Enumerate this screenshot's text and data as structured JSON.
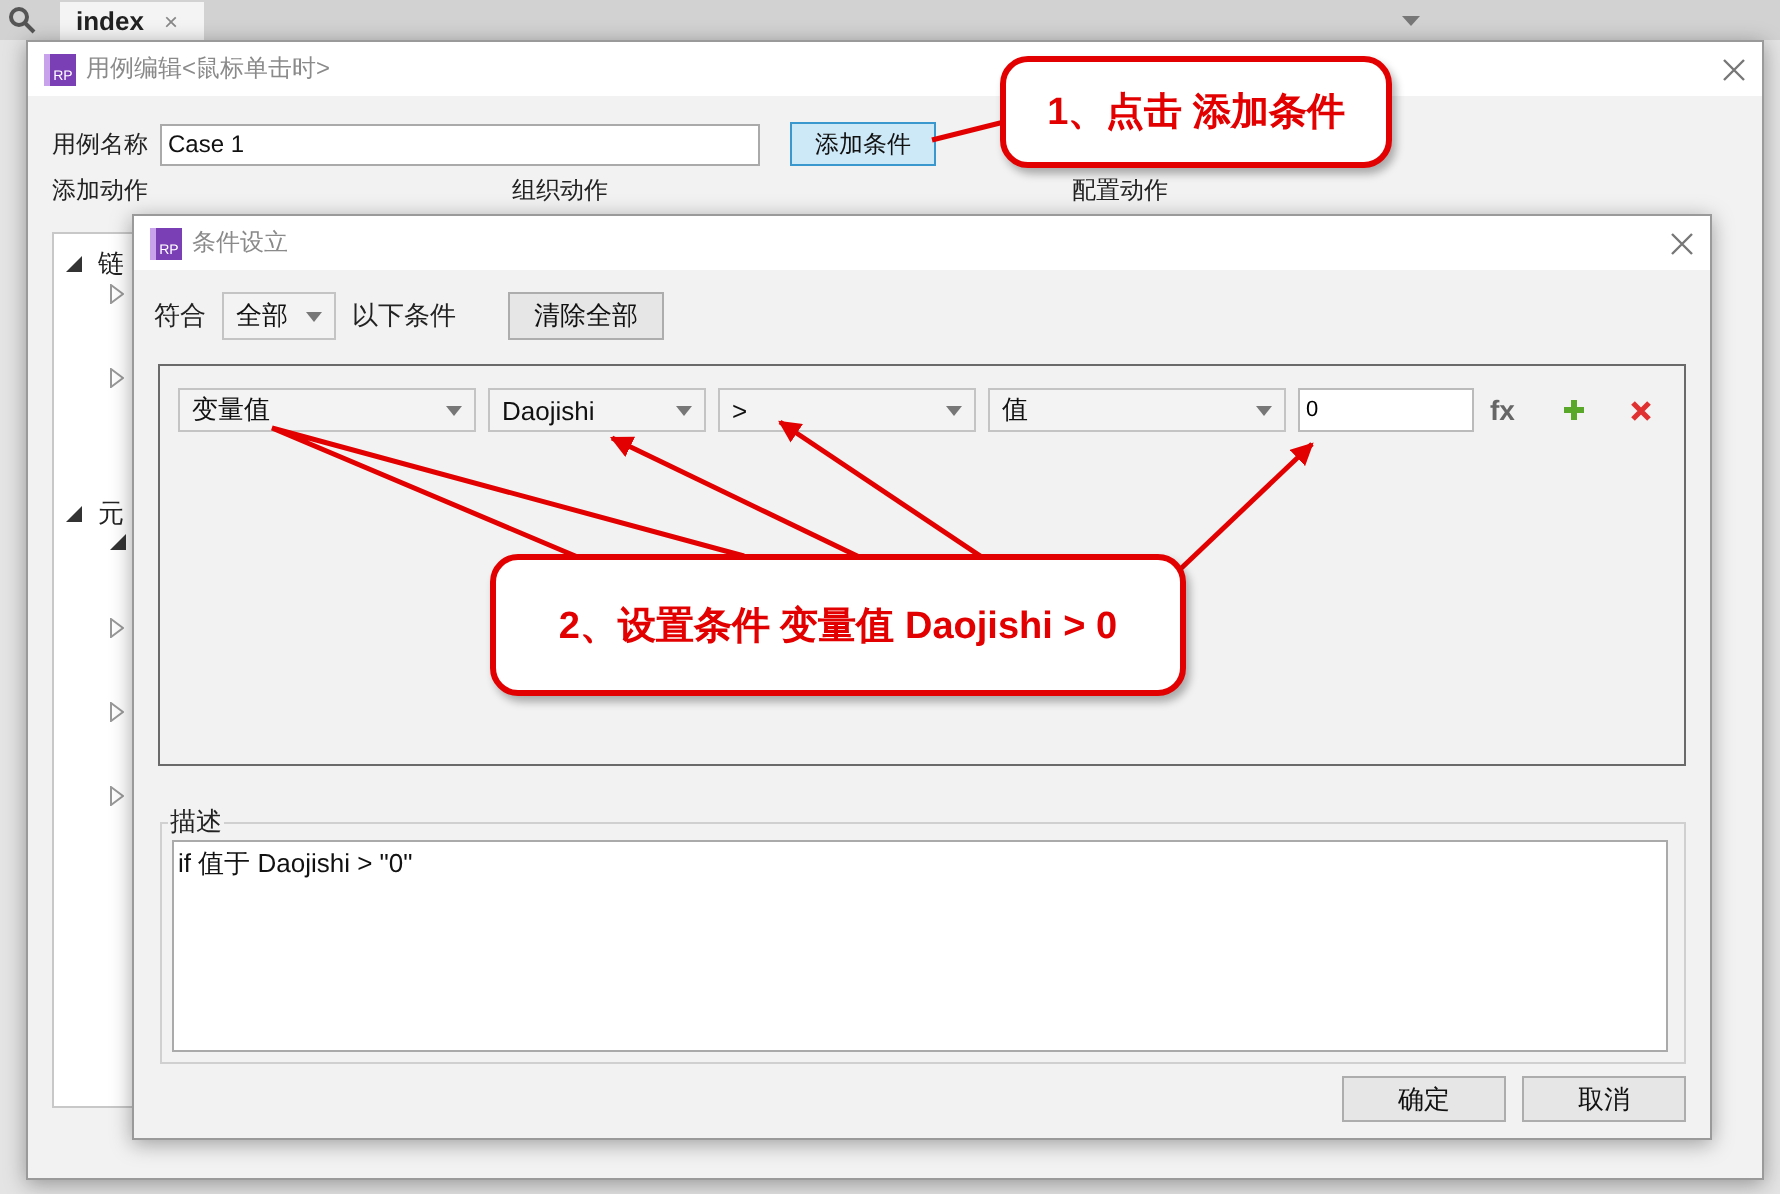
{
  "background": {
    "tab": {
      "label": "index",
      "close": "×"
    }
  },
  "case_dialog": {
    "logo": "RP",
    "title": "用例编辑<鼠标单击时>",
    "name_label": "用例名称",
    "name_value": "Case 1",
    "add_condition_button": "添加条件",
    "columns": [
      "添加动作",
      "组织动作",
      "配置动作"
    ],
    "tree": [
      {
        "label": "链",
        "expanded": true,
        "children": [
          {
            "expanded": false
          },
          {
            "expanded": false
          }
        ]
      },
      {
        "label": "元",
        "expanded": true,
        "children": [
          {
            "expanded": true
          },
          {
            "expanded": false
          },
          {
            "expanded": false
          },
          {
            "expanded": false
          }
        ]
      }
    ]
  },
  "condition_dialog": {
    "logo": "RP",
    "title": "条件设立",
    "match_label": "符合",
    "match_select": "全部",
    "match_suffix": "以下条件",
    "clear_button": "清除全部",
    "conditions": [
      {
        "fields": [
          {
            "kind": "select",
            "value": "变量值"
          },
          {
            "kind": "select",
            "value": "Daojishi"
          },
          {
            "kind": "select",
            "value": ">"
          },
          {
            "kind": "select",
            "value": "值"
          },
          {
            "kind": "input",
            "value": "0"
          }
        ],
        "fx": "fx"
      }
    ],
    "description_label": "描述",
    "description": "if 值于 Daojishi > \"0\"",
    "buttons": [
      "确定",
      "取消"
    ]
  },
  "annotations": [
    {
      "text": "1、点击 添加条件"
    },
    {
      "text": "2、设置条件 变量值 Daojishi > 0"
    }
  ]
}
